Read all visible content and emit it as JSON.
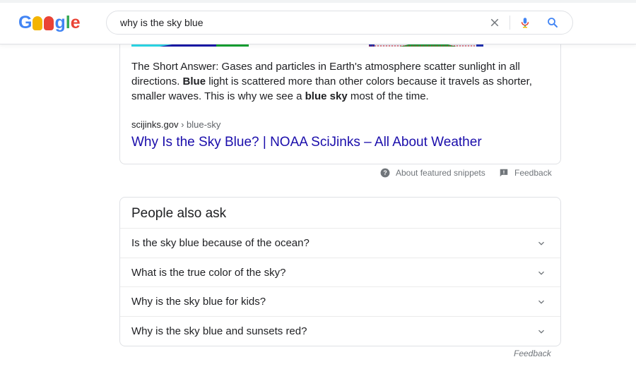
{
  "header": {
    "logo_icon": "google-doodle-logo-icon",
    "search_query": "why is the sky blue",
    "clear_icon": "close-icon",
    "mic_icon": "microphone-icon",
    "search_icon": "search-icon"
  },
  "snippet": {
    "text_parts": {
      "p1": "The Short Answer: Gases and particles in Earth's atmosphere scatter sunlight in all directions. ",
      "b1": "Blue",
      "p2": " light is scattered more than other colors because it travels as shorter, smaller waves. This is why we see a ",
      "b2": "blue sky",
      "p3": " most of the time."
    },
    "cite_domain": "scijinks.gov",
    "cite_path": " › blue-sky",
    "title": "Why Is the Sky Blue? | NOAA SciJinks – All About Weather"
  },
  "snippet_footer": {
    "about_label": "About featured snippets",
    "feedback_label": "Feedback"
  },
  "people_also_ask": {
    "title": "People also ask",
    "questions": [
      "Is the sky blue because of the ocean?",
      "What is the true color of the sky?",
      "Why is the sky blue for kids?",
      "Why is the sky blue and sunsets red?"
    ]
  },
  "bottom_feedback": "Feedback",
  "colors": {
    "link": "#1a0dab",
    "text": "#202124",
    "muted": "#70757a",
    "border": "#dfe1e5"
  }
}
